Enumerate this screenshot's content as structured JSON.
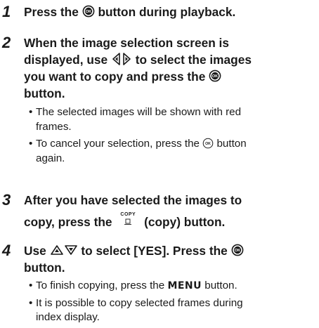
{
  "steps": [
    {
      "number": "1",
      "lines": [
        {
          "pre": "Press the",
          "icon": "ok-button-icon",
          "post": "button during playback."
        }
      ]
    },
    {
      "number": "2",
      "lines": [
        {
          "text": "When the image selection screen is"
        },
        {
          "pre": "displayed, use",
          "icon": "left-right-arrows-icon",
          "post": "to select the images"
        },
        {
          "pre": "you want to copy and press the",
          "icon": "ok-button-icon"
        },
        {
          "text": "button."
        }
      ],
      "bullets": [
        [
          "The selected images will be shown with red",
          "frames."
        ],
        [
          "To cancel your selection, press the",
          "button",
          "again."
        ]
      ]
    },
    {
      "number": "3",
      "lines": [
        {
          "text": "After you have selected the images to"
        },
        {
          "pre": "copy, press the",
          "icon": "copy-button-icon",
          "icon_text": "COPY",
          "post": "(copy) button."
        }
      ]
    },
    {
      "number": "4",
      "lines": [
        {
          "pre": "Use",
          "icon": "up-down-arrows-icon",
          "post": "to select [YES]. Press the"
        },
        {
          "text": "button."
        }
      ],
      "bullets": [
        [
          "To finish copying, press the",
          "MENU",
          "button."
        ],
        [
          "It is possible to copy selected frames during",
          "index display."
        ]
      ]
    }
  ],
  "bullet_glyph": "•",
  "colors": {
    "text": "#1a1a1a",
    "background": "#ffffff"
  }
}
